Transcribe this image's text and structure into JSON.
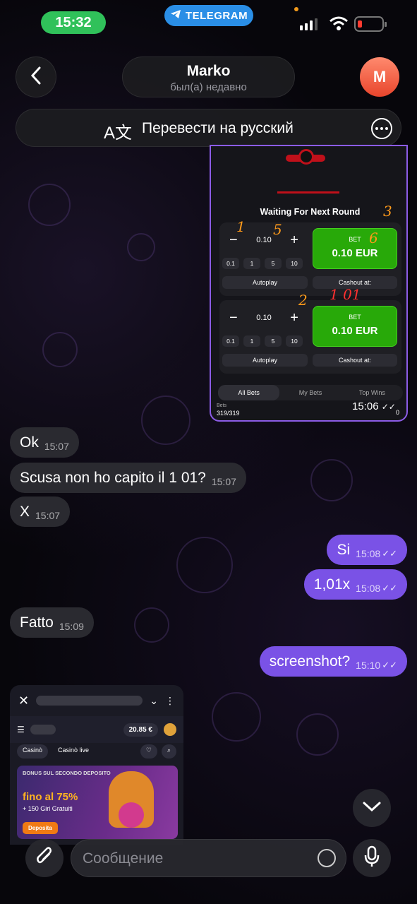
{
  "status_bar": {
    "time": "15:32",
    "app_badge": "TELEGRAM"
  },
  "header": {
    "contact_name": "Marko",
    "contact_status": "был(а) недавно",
    "avatar_letter": "M",
    "translate_label": "Перевести на русский"
  },
  "game_screenshot": {
    "status_text": "Waiting For Next Round",
    "panels": [
      {
        "amount": "0.10",
        "quick": [
          "0.1",
          "1",
          "5",
          "10"
        ],
        "autoplay": "Autoplay",
        "bet_label": "BET",
        "bet_amount": "0.10 EUR",
        "cashout": "Cashout at:"
      },
      {
        "amount": "0.10",
        "quick": [
          "0.1",
          "1",
          "5",
          "10"
        ],
        "autoplay": "Autoplay",
        "bet_label": "BET",
        "bet_amount": "0.10 EUR",
        "cashout": "Cashout at:"
      }
    ],
    "tabs": [
      "All Bets",
      "My Bets",
      "Top Wins"
    ],
    "bets_label": "Bets",
    "bets_count": "319/319",
    "right_value": "0",
    "annotations": [
      "1",
      "5",
      "3",
      "6",
      "2",
      "1 01"
    ],
    "time": "15:06"
  },
  "messages": [
    {
      "dir": "in",
      "text": "Ok",
      "time": "15:07"
    },
    {
      "dir": "in",
      "text": "Scusa non ho capito  il 1 01?",
      "time": "15:07"
    },
    {
      "dir": "in",
      "text": "X",
      "time": "15:07"
    },
    {
      "dir": "out",
      "text": "Si",
      "time": "15:08"
    },
    {
      "dir": "out",
      "text": "1,01x",
      "time": "15:08"
    },
    {
      "dir": "in",
      "text": "Fatto",
      "time": "15:09"
    },
    {
      "dir": "out",
      "text": "screenshot?",
      "time": "15:10"
    }
  ],
  "casino_screenshot": {
    "balance": "20.85 €",
    "tab_casino": "Casinò",
    "tab_live": "Casinò live",
    "promo_title": "BONUS SUL SECONDO DEPOSITO",
    "promo_percent": "fino al 75%",
    "promo_spins": "+ 150 Giri Gratuiti",
    "promo_button": "Deposita"
  },
  "composer": {
    "placeholder": "Сообщение"
  },
  "colors": {
    "outgoing": "#7a52e6",
    "incoming": "#2a2a30",
    "bet_green": "#28a909",
    "time_pill": "#30c15a",
    "telegram_blue": "#2a8ee6"
  }
}
